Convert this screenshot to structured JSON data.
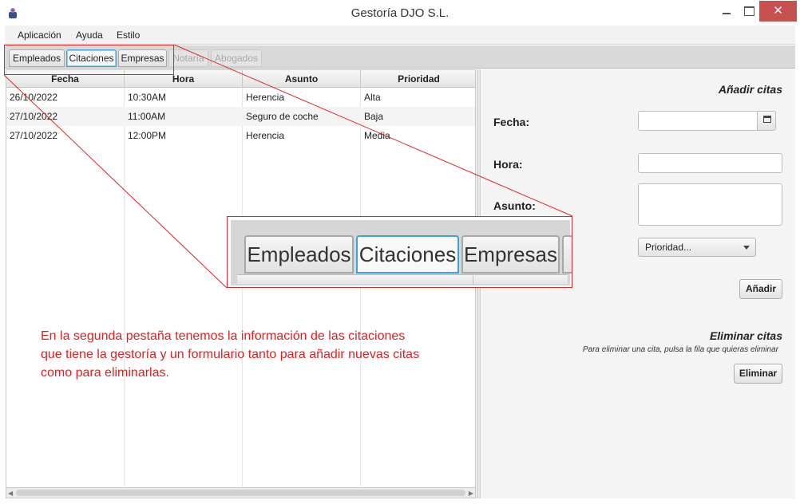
{
  "window": {
    "title": "Gestoría DJO S.L.",
    "close_glyph": "✕",
    "icon": "duke-java-icon"
  },
  "menu": [
    {
      "label": "Aplicación"
    },
    {
      "label": "Ayuda"
    },
    {
      "label": "Estilo"
    }
  ],
  "tabs": [
    {
      "label": "Empleados",
      "state": "normal"
    },
    {
      "label": "Citaciones",
      "state": "selected"
    },
    {
      "label": "Empresas",
      "state": "normal"
    },
    {
      "label": "Notaría",
      "state": "disabled"
    },
    {
      "label": "Abogados",
      "state": "disabled"
    }
  ],
  "table": {
    "columns": [
      "Fecha",
      "Hora",
      "Asunto",
      "Prioridad"
    ],
    "rows": [
      [
        "26/10/2022",
        "10:30AM",
        "Herencia",
        "Alta"
      ],
      [
        "27/10/2022",
        "11:00AM",
        "Seguro de coche",
        "Baja"
      ],
      [
        "27/10/2022",
        "12:00PM",
        "Herencia",
        "Media"
      ]
    ]
  },
  "form": {
    "add_heading": "Añadir citas",
    "fecha_label": "Fecha:",
    "hora_label": "Hora:",
    "asunto_label": "Asunto:",
    "prioridad_placeholder": "Prioridad...",
    "add_button": "Añadir",
    "delete_heading": "Eliminar citas",
    "delete_hint": "Para eliminar una cita, pulsa la fila que quieras eliminar",
    "delete_button": "Eliminar",
    "fecha_value": "",
    "hora_value": "",
    "asunto_value": ""
  },
  "annotation": {
    "zoom_tabs": [
      "Empleados",
      "Citaciones",
      "Empresas"
    ],
    "text_lines": [
      "En la segunda pestaña tenemos la información de las citaciones",
      "que tiene la gestoría y un formulario tanto para añadir nuevas citas",
      "como para eliminarlas."
    ],
    "color": "#e0282a"
  },
  "colors": {
    "accent_tab_border": "#3ea2d8",
    "close_button": "#c75050",
    "annotation_red": "#e0282a"
  }
}
